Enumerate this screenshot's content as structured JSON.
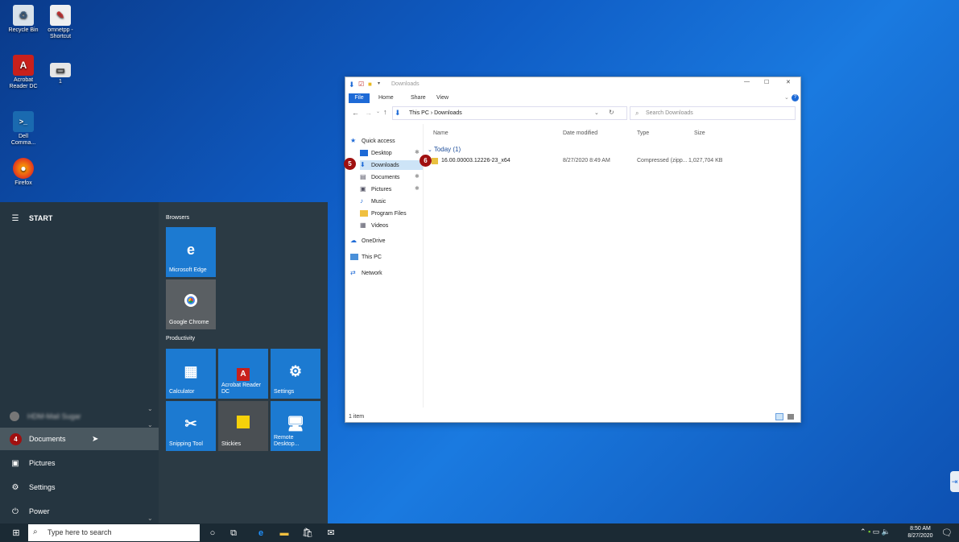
{
  "desktop": {
    "icons": [
      {
        "label": "Recycle Bin",
        "glyph": "♻"
      },
      {
        "label": "omnetpp - Shortcut",
        "glyph": "✎"
      },
      {
        "label": "Acrobat Reader DC",
        "glyph": "A"
      },
      {
        "label": "1",
        "glyph": "▭"
      },
      {
        "label": "Dell Comma...",
        "glyph": ">_"
      },
      {
        "label": "Firefox",
        "glyph": "●"
      }
    ]
  },
  "start": {
    "header": "START",
    "user_name": "HDM-Mail Sugar",
    "items": [
      {
        "label": "Documents",
        "icon": "document-icon"
      },
      {
        "label": "Pictures",
        "icon": "pictures-icon"
      },
      {
        "label": "Settings",
        "icon": "gear-icon"
      },
      {
        "label": "Power",
        "icon": "power-icon"
      }
    ],
    "groups": {
      "browsers": "Browsers",
      "productivity": "Productivity"
    },
    "tiles": {
      "edge": "Microsoft Edge",
      "chrome": "Google Chrome",
      "calculator": "Calculator",
      "acrobat": "Acrobat Reader DC",
      "settings": "Settings",
      "snipping": "Snipping Tool",
      "stickies": "Stickies",
      "remote": "Remote Desktop..."
    }
  },
  "badges": {
    "b4": "4",
    "b5": "5",
    "b6": "6"
  },
  "explorer": {
    "title": "Downloads",
    "ribbon_tabs": [
      "File",
      "Home",
      "Share",
      "View"
    ],
    "breadcrumb": "This PC  ›  Downloads",
    "search_placeholder": "Search Downloads",
    "nav": {
      "quick_access": "Quick access",
      "desktop": "Desktop",
      "downloads": "Downloads",
      "documents": "Documents",
      "pictures": "Pictures",
      "music": "Music",
      "program_files": "Program Files",
      "videos": "Videos",
      "onedrive": "OneDrive",
      "this_pc": "This PC",
      "network": "Network"
    },
    "columns": {
      "name": "Name",
      "date": "Date modified",
      "type": "Type",
      "size": "Size"
    },
    "group_label": "Today (1)",
    "file": {
      "name": "16.00.00003.12226-23_x64",
      "date": "8/27/2020 8:49 AM",
      "type": "Compressed (zipp...",
      "size": "1,027,704 KB"
    },
    "status": "1 item"
  },
  "taskbar": {
    "search_placeholder": "Type here to search",
    "time": "8:50 AM",
    "date": "8/27/2020"
  }
}
